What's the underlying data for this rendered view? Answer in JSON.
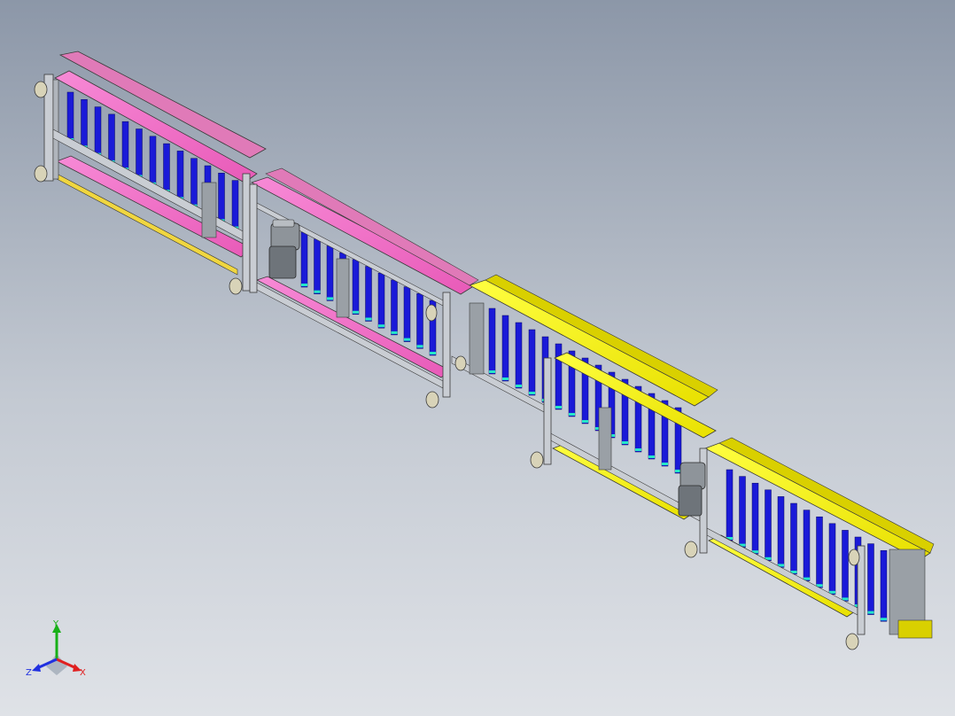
{
  "viewport": {
    "background_top": "#8c97a8",
    "background_bottom": "#dfe2e7"
  },
  "model": {
    "sections": [
      {
        "name": "pink-section-1",
        "color": "#f46fc8"
      },
      {
        "name": "pink-section-2",
        "color": "#f46fc8"
      },
      {
        "name": "yellow-section-1",
        "color": "#f5f000"
      },
      {
        "name": "yellow-section-2",
        "color": "#f5f000"
      }
    ],
    "roller_color": "#1a1ad8",
    "frame_color": "#c9cdd3",
    "frame_edge_color": "#3a3a3a",
    "foot_color": "#d8d3b8",
    "motor_color": "#9aa0a6",
    "accent_color": "#25e6c8"
  },
  "triad": {
    "x_label": "X",
    "y_label": "Y",
    "z_label": "Z",
    "x_color": "#e02020",
    "y_color": "#18b018",
    "z_color": "#2030e0"
  }
}
